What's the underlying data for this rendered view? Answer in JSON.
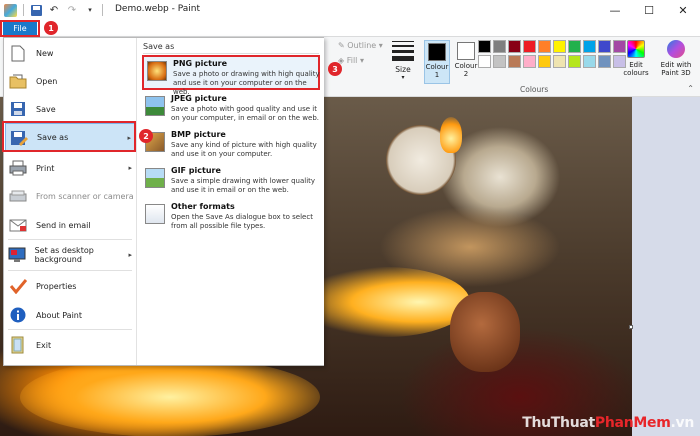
{
  "window": {
    "title": "Demo.webp - Paint",
    "minimize": "—",
    "maximize": "☐",
    "close": "✕"
  },
  "ribbon": {
    "file_tab": "File",
    "outline": "Outline",
    "fill": "Fill",
    "size": "Size",
    "colour1": "Colour 1",
    "colour2": "Colour 2",
    "colours_group": "Colours",
    "edit_colours": "Edit colours",
    "edit_paint3d": "Edit with Paint 3D",
    "palette": [
      "#000000",
      "#7f7f7f",
      "#880015",
      "#ed1c24",
      "#ff7f27",
      "#fff200",
      "#22b14c",
      "#00a2e8",
      "#3f48cc",
      "#a349a4",
      "#ffffff",
      "#c3c3c3",
      "#b97a57",
      "#ffaec9",
      "#ffc90e",
      "#efe4b0",
      "#b5e61d",
      "#99d9ea",
      "#7092be",
      "#c8bfe7"
    ]
  },
  "file_menu": {
    "items": [
      {
        "label": "New"
      },
      {
        "label": "Open"
      },
      {
        "label": "Save"
      },
      {
        "label": "Save as"
      },
      {
        "label": "Print"
      },
      {
        "label": "From scanner or camera"
      },
      {
        "label": "Send in email"
      },
      {
        "label": "Set as desktop background"
      },
      {
        "label": "Properties"
      },
      {
        "label": "About Paint"
      },
      {
        "label": "Exit"
      }
    ],
    "save_as": {
      "header": "Save as",
      "options": [
        {
          "title": "PNG picture",
          "desc": "Save a photo or drawing with high quality and use it on your computer or on the web."
        },
        {
          "title": "JPEG picture",
          "desc": "Save a photo with good quality and use it on your computer, in email or on the web."
        },
        {
          "title": "BMP picture",
          "desc": "Save any kind of picture with high quality and use it on your computer."
        },
        {
          "title": "GIF picture",
          "desc": "Save a simple drawing with lower quality and use it in email or on the web."
        },
        {
          "title": "Other formats",
          "desc": "Open the Save As dialogue box to select from all possible file types."
        }
      ]
    }
  },
  "annotations": {
    "step1": "1",
    "step2": "2",
    "step3": "3"
  },
  "watermark": {
    "part1": "ThuThuat",
    "part2": "PhanMem",
    "part3": ".vn"
  }
}
